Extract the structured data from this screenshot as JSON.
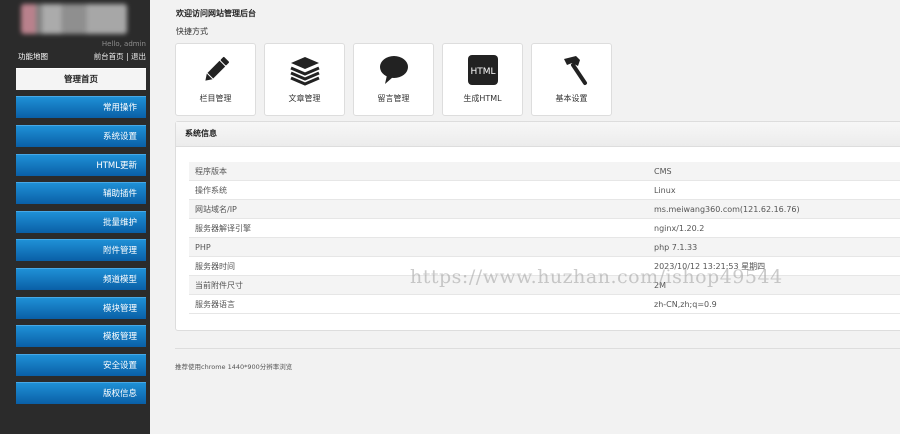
{
  "sidebar": {
    "greeting": "Hello, admin",
    "site_map_label": "功能地图",
    "home_link": "前台首页",
    "separator": "|",
    "logout_link": "退出",
    "items": [
      {
        "label": "管理首页"
      },
      {
        "label": "常用操作"
      },
      {
        "label": "系统设置"
      },
      {
        "label": "HTML更新"
      },
      {
        "label": "辅助插件"
      },
      {
        "label": "批量维护"
      },
      {
        "label": "附件管理"
      },
      {
        "label": "频道模型"
      },
      {
        "label": "模块管理"
      },
      {
        "label": "模板管理"
      },
      {
        "label": "安全设置"
      },
      {
        "label": "版权信息"
      }
    ]
  },
  "main": {
    "welcome": "欢迎访问网站管理后台",
    "quick_title": "快捷方式",
    "shortcuts": [
      {
        "label": "栏目管理",
        "icon": "pencil-icon"
      },
      {
        "label": "文章管理",
        "icon": "stack-icon"
      },
      {
        "label": "留言管理",
        "icon": "speech-bubble-icon"
      },
      {
        "label": "生成HTML",
        "icon": "html-icon",
        "icon_text": "HTML"
      },
      {
        "label": "基本设置",
        "icon": "hammer-icon"
      }
    ],
    "system_panel": {
      "title": "系统信息",
      "rows": [
        {
          "key": "程序版本",
          "value": "CMS"
        },
        {
          "key": "操作系统",
          "value": "Linux"
        },
        {
          "key": "网站域名/IP",
          "value": "ms.meiwang360.com(121.62.16.76)"
        },
        {
          "key": "服务器解译引擎",
          "value": "nginx/1.20.2"
        },
        {
          "key": "PHP",
          "value": "php 7.1.33"
        },
        {
          "key": "服务器时间",
          "value": "2023/10/12 13:21:53 星期四"
        },
        {
          "key": "当前附件尺寸",
          "value": "2M"
        },
        {
          "key": "服务器语言",
          "value": "zh-CN,zh;q=0.9"
        }
      ]
    },
    "footer_note": "推荐使用chrome 1440*900分辨率浏览"
  },
  "watermark": "https://www.huzhan.com/ishop49544",
  "colors": {
    "sidebar_bg": "#2b2b2b",
    "nav_blue": "#0a5fa6",
    "page_bg": "#f2f2f2"
  }
}
